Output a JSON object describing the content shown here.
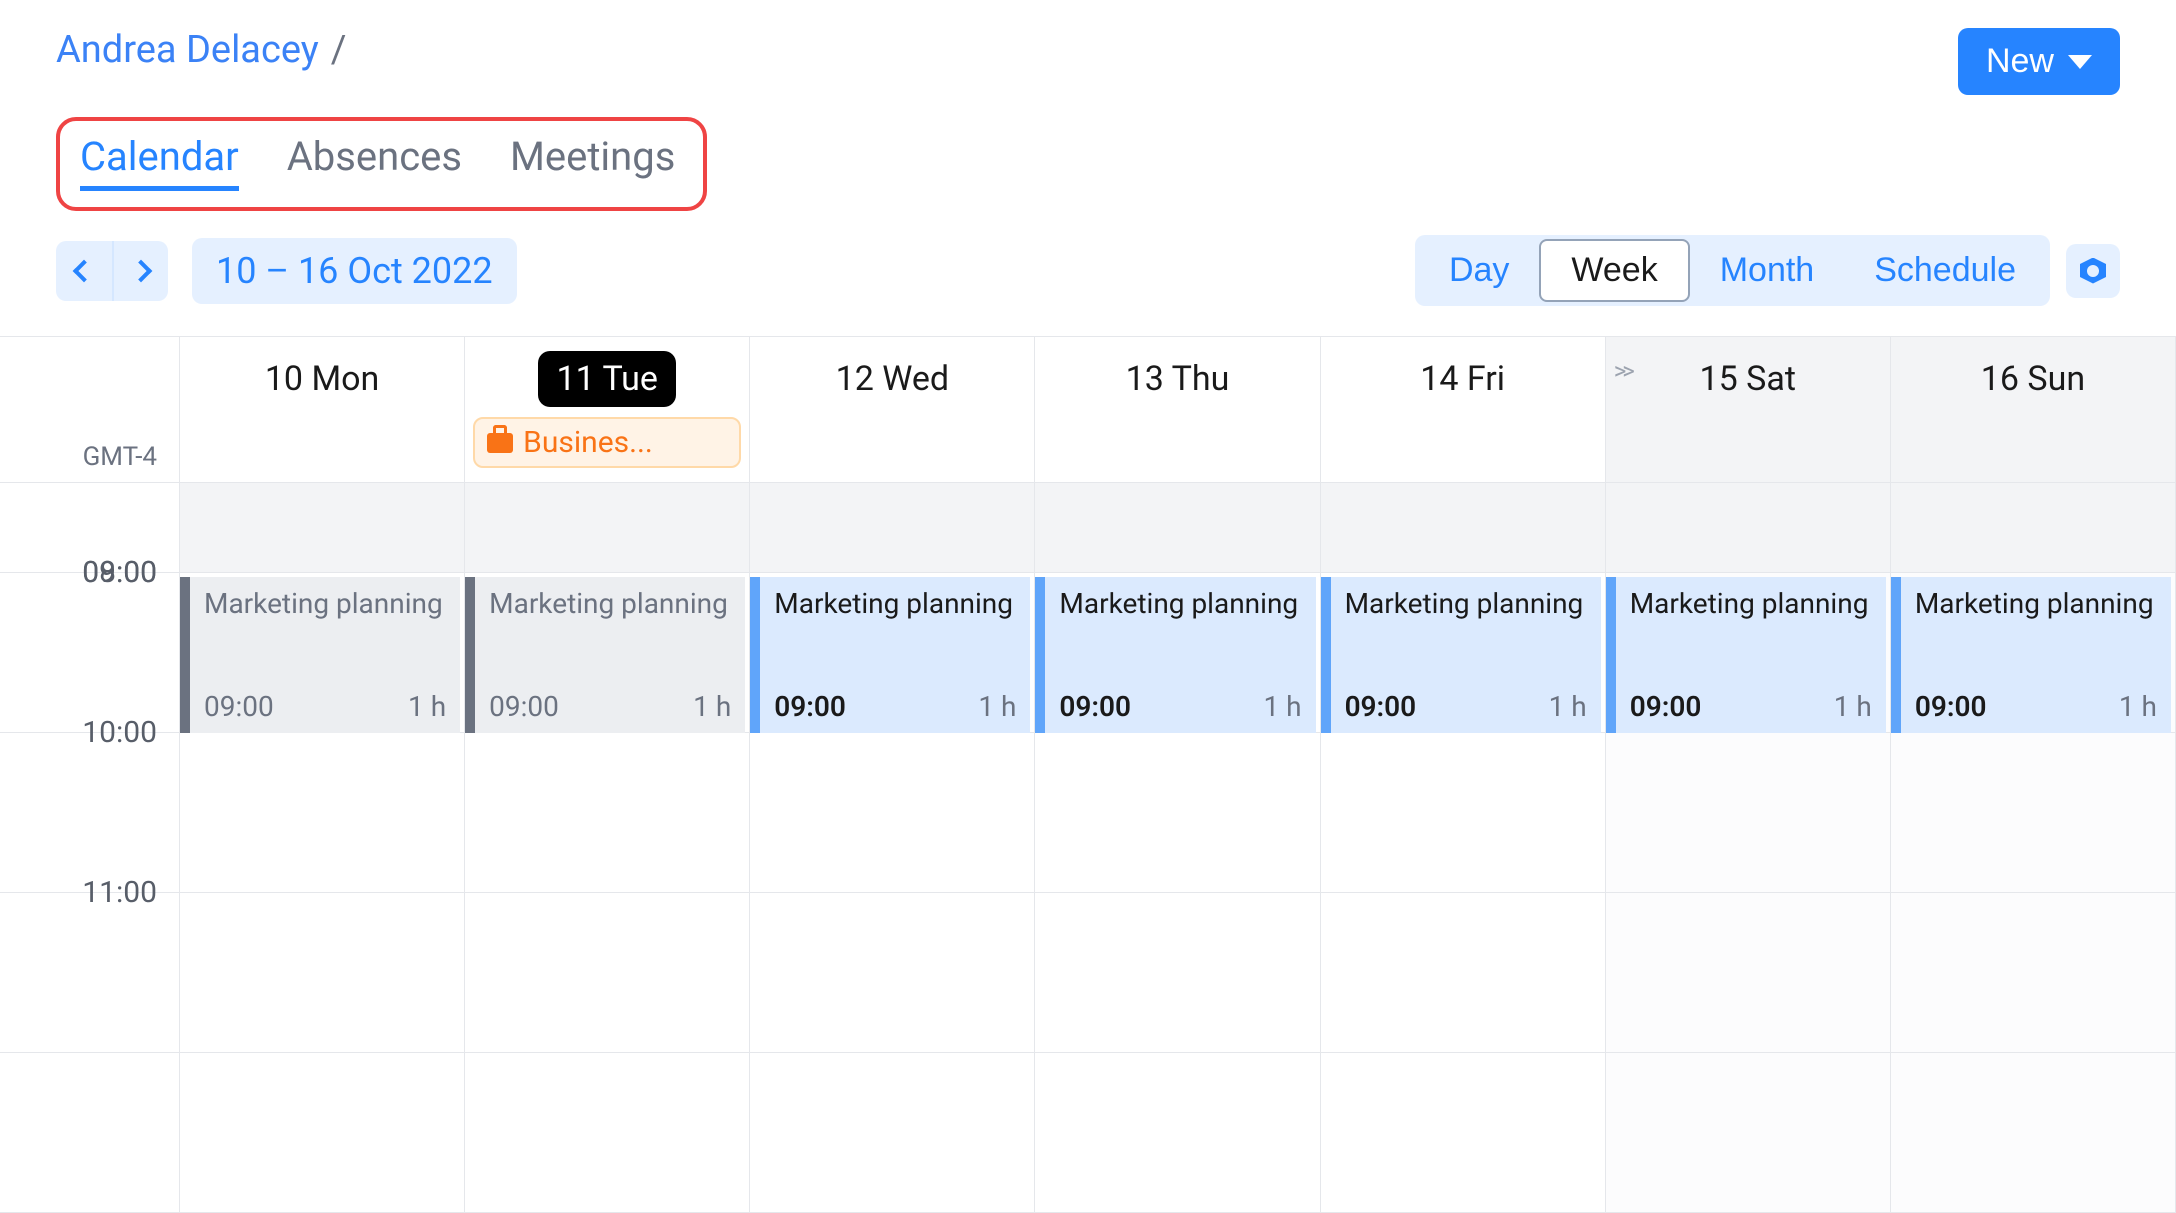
{
  "breadcrumb": {
    "user": "Andrea Delacey",
    "sep": "/"
  },
  "new_button": {
    "label": "New"
  },
  "tabs": [
    {
      "label": "Calendar",
      "active": true
    },
    {
      "label": "Absences",
      "active": false
    },
    {
      "label": "Meetings",
      "active": false
    }
  ],
  "toolbar": {
    "date_range": "10 – 16 Oct 2022",
    "views": [
      {
        "label": "Day",
        "active": false
      },
      {
        "label": "Week",
        "active": true
      },
      {
        "label": "Month",
        "active": false
      },
      {
        "label": "Schedule",
        "active": false
      }
    ]
  },
  "timezone": "GMT-4",
  "time_labels": [
    "08:00",
    "09:00",
    "10:00",
    "11:00"
  ],
  "days": [
    {
      "label": "10 Mon",
      "today": false,
      "weekend": false,
      "allday": null,
      "expand": false
    },
    {
      "label": "11 Tue",
      "today": true,
      "weekend": false,
      "allday": "Busines...",
      "expand": false
    },
    {
      "label": "12 Wed",
      "today": false,
      "weekend": false,
      "allday": null,
      "expand": false
    },
    {
      "label": "13 Thu",
      "today": false,
      "weekend": false,
      "allday": null,
      "expand": false
    },
    {
      "label": "14 Fri",
      "today": false,
      "weekend": false,
      "allday": null,
      "expand": false
    },
    {
      "label": "15 Sat",
      "today": false,
      "weekend": true,
      "allday": null,
      "expand": true
    },
    {
      "label": "16 Sun",
      "today": false,
      "weekend": true,
      "allday": null,
      "expand": false
    }
  ],
  "events": [
    {
      "day": 0,
      "title": "Marketing planning",
      "time": "09:00",
      "duration": "1 h",
      "past": true
    },
    {
      "day": 1,
      "title": "Marketing planning",
      "time": "09:00",
      "duration": "1 h",
      "past": true
    },
    {
      "day": 2,
      "title": "Marketing planning",
      "time": "09:00",
      "duration": "1 h",
      "past": false
    },
    {
      "day": 3,
      "title": "Marketing planning",
      "time": "09:00",
      "duration": "1 h",
      "past": false
    },
    {
      "day": 4,
      "title": "Marketing planning",
      "time": "09:00",
      "duration": "1 h",
      "past": false
    },
    {
      "day": 5,
      "title": "Marketing planning",
      "time": "09:00",
      "duration": "1 h",
      "past": false
    },
    {
      "day": 6,
      "title": "Marketing planning",
      "time": "09:00",
      "duration": "1 h",
      "past": false
    }
  ]
}
